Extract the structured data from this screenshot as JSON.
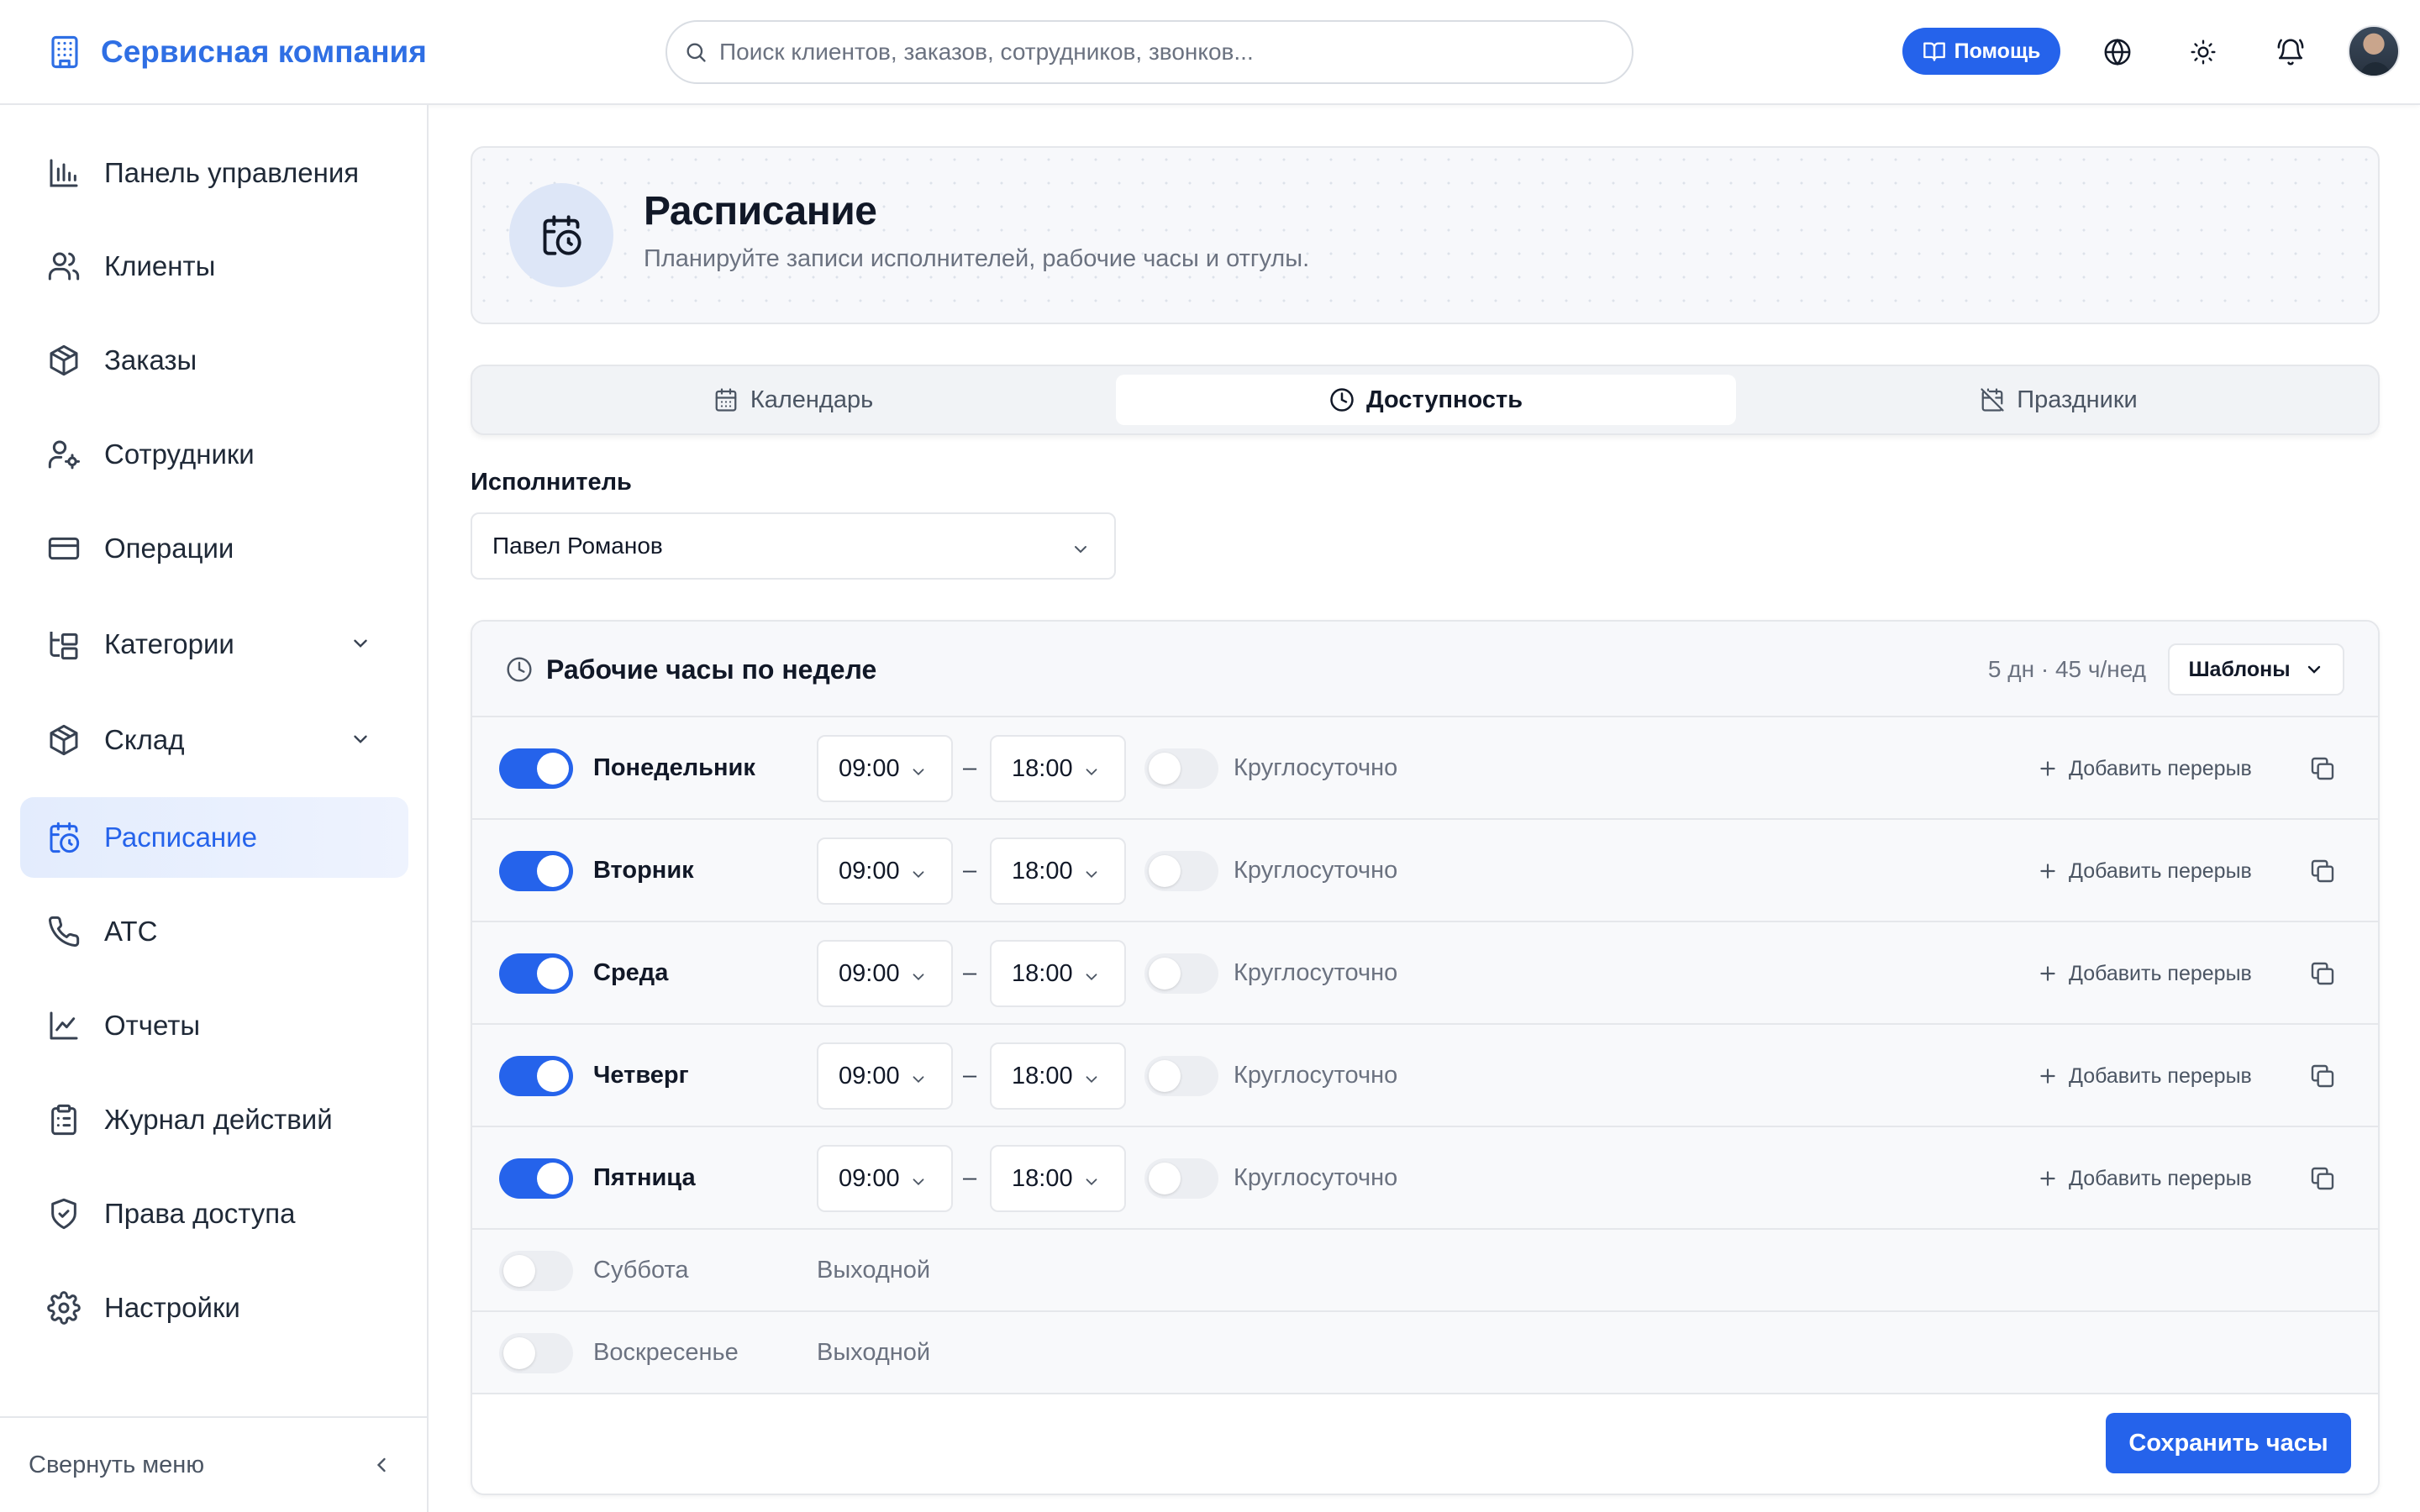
{
  "app": {
    "name": "Сервисная компания"
  },
  "header": {
    "search_placeholder": "Поиск клиентов, заказов, сотрудников, звонков...",
    "help_label": "Помощь"
  },
  "sidebar": {
    "items": [
      {
        "label": "Панель управления",
        "icon": "bar-chart-icon"
      },
      {
        "label": "Клиенты",
        "icon": "users-icon"
      },
      {
        "label": "Заказы",
        "icon": "package-icon"
      },
      {
        "label": "Сотрудники",
        "icon": "user-cog-icon"
      },
      {
        "label": "Операции",
        "icon": "credit-card-icon"
      },
      {
        "label": "Категории",
        "icon": "folder-tree-icon",
        "expandable": true
      },
      {
        "label": "Склад",
        "icon": "package-icon",
        "expandable": true
      },
      {
        "label": "Расписание",
        "icon": "calendar-clock-icon",
        "active": true
      },
      {
        "label": "АТС",
        "icon": "phone-icon"
      },
      {
        "label": "Отчеты",
        "icon": "line-chart-icon"
      },
      {
        "label": "Журнал действий",
        "icon": "clipboard-list-icon"
      },
      {
        "label": "Права доступа",
        "icon": "shield-check-icon"
      },
      {
        "label": "Настройки",
        "icon": "settings-icon"
      }
    ],
    "collapse_label": "Свернуть меню"
  },
  "page": {
    "title": "Расписание",
    "subtitle": "Планируйте записи исполнителей, рабочие часы и отгулы."
  },
  "tabs": [
    {
      "label": "Календарь",
      "icon": "calendar-icon",
      "active": false
    },
    {
      "label": "Доступность",
      "icon": "clock-icon",
      "active": true
    },
    {
      "label": "Праздники",
      "icon": "calendar-off-icon",
      "active": false
    }
  ],
  "performer": {
    "label": "Исполнитель",
    "value": "Павел Романов"
  },
  "hours": {
    "title": "Рабочие часы по неделе",
    "summary": "5 дн · 45 ч/нед",
    "templates_label": "Шаблоны",
    "allday_label": "Круглосуточно",
    "add_break_label": "Добавить перерыв",
    "dayoff_label": "Выходной",
    "save_label": "Сохранить часы",
    "days": [
      {
        "name": "Понедельник",
        "enabled": true,
        "start": "09:00",
        "end": "18:00",
        "allday": false
      },
      {
        "name": "Вторник",
        "enabled": true,
        "start": "09:00",
        "end": "18:00",
        "allday": false
      },
      {
        "name": "Среда",
        "enabled": true,
        "start": "09:00",
        "end": "18:00",
        "allday": false
      },
      {
        "name": "Четверг",
        "enabled": true,
        "start": "09:00",
        "end": "18:00",
        "allday": false
      },
      {
        "name": "Пятница",
        "enabled": true,
        "start": "09:00",
        "end": "18:00",
        "allday": false
      },
      {
        "name": "Суббота",
        "enabled": false
      },
      {
        "name": "Воскресенье",
        "enabled": false
      }
    ]
  },
  "colors": {
    "accent": "#2563eb",
    "brand": "#2f6fe4"
  }
}
